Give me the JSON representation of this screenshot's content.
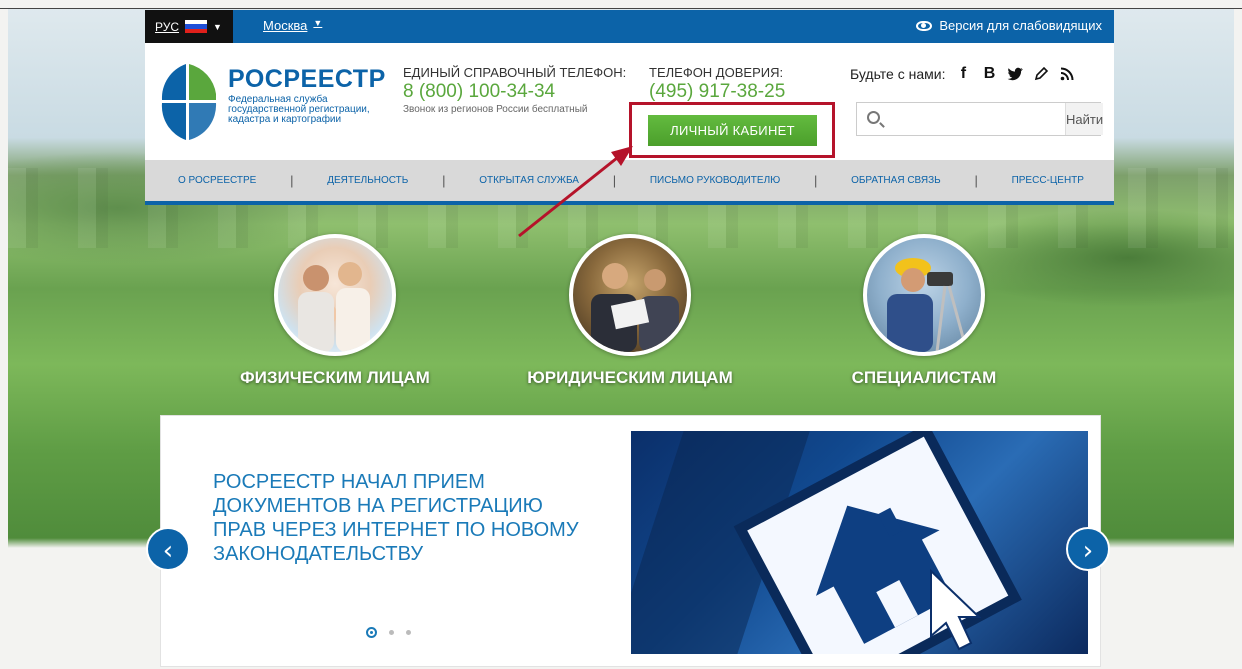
{
  "topbar": {
    "lang": "РУС",
    "city": "Москва",
    "vision": "Версия для слабовидящих",
    "flag_colors": [
      "#ffffff",
      "#1f4fd8",
      "#e0201b"
    ]
  },
  "brand": {
    "name": "РОСРЕЕСТР",
    "desc_1": "Федеральная служба",
    "desc_2": "государственной регистрации,",
    "desc_3": "кадастра и картографии"
  },
  "phone": {
    "label": "ЕДИНЫЙ СПРАВОЧНЫЙ ТЕЛЕФОН:",
    "number": "8 (800) 100-34-34",
    "note": "Звонок из регионов России бесплатный"
  },
  "trust": {
    "label": "ТЕЛЕФОН ДОВЕРИЯ:",
    "number": "(495) 917-38-25"
  },
  "social": {
    "label": "Будьте с нами:",
    "icons": [
      "f",
      "B",
      "twitter-icon",
      "blog-icon",
      "rss-icon"
    ]
  },
  "search": {
    "placeholder": "",
    "button": "Найти"
  },
  "cabinet_button": "ЛИЧНЫЙ КАБИНЕТ",
  "nav": [
    "О РОСРЕЕСТРЕ",
    "ДЕЯТЕЛЬНОСТЬ",
    "ОТКРЫТАЯ СЛУЖБА",
    "ПИСЬМО РУКОВОДИТЕЛЮ",
    "ОБРАТНАЯ СВЯЗЬ",
    "ПРЕСС-ЦЕНТР"
  ],
  "audiences": [
    {
      "label": "ФИЗИЧЕСКИМ ЛИЦАМ"
    },
    {
      "label": "ЮРИДИЧЕСКИМ ЛИЦАМ"
    },
    {
      "label": "СПЕЦИАЛИСТАМ"
    }
  ],
  "slide": {
    "title_1": "РОСРЕЕСТР НАЧАЛ ПРИЕМ",
    "title_2": "ДОКУМЕНТОВ НА РЕГИСТРАЦИЮ",
    "title_3": "ПРАВ ЧЕРЕЗ ИНТЕРНЕТ ПО НОВОМУ",
    "title_4": "ЗАКОНОДАТЕЛЬСТВУ",
    "active_index": 1,
    "count": 3
  },
  "colors": {
    "primary": "#0c63a8",
    "green": "#5aa73d",
    "highlight": "#b5132a"
  }
}
